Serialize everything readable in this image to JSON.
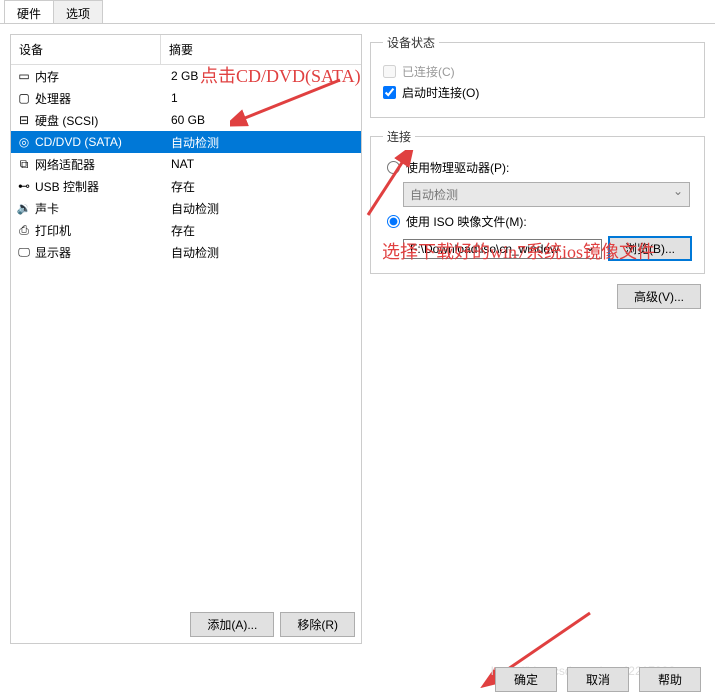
{
  "tabs": {
    "hardware": "硬件",
    "options": "选项"
  },
  "headers": {
    "device": "设备",
    "summary": "摘要"
  },
  "devices": [
    {
      "icon": "memory-icon",
      "glyph": "▭",
      "name": "内存",
      "summary": "2 GB"
    },
    {
      "icon": "cpu-icon",
      "glyph": "▢",
      "name": "处理器",
      "summary": "1"
    },
    {
      "icon": "disk-icon",
      "glyph": "⊟",
      "name": "硬盘 (SCSI)",
      "summary": "60 GB"
    },
    {
      "icon": "cd-icon",
      "glyph": "◎",
      "name": "CD/DVD (SATA)",
      "summary": "自动检测"
    },
    {
      "icon": "network-icon",
      "glyph": "⧉",
      "name": "网络适配器",
      "summary": "NAT"
    },
    {
      "icon": "usb-icon",
      "glyph": "⊷",
      "name": "USB 控制器",
      "summary": "存在"
    },
    {
      "icon": "sound-icon",
      "glyph": "🔉",
      "name": "声卡",
      "summary": "自动检测"
    },
    {
      "icon": "printer-icon",
      "glyph": "⎙",
      "name": "打印机",
      "summary": "存在"
    },
    {
      "icon": "display-icon",
      "glyph": "🖵",
      "name": "显示器",
      "summary": "自动检测"
    }
  ],
  "left_buttons": {
    "add": "添加(A)...",
    "remove": "移除(R)"
  },
  "status": {
    "legend": "设备状态",
    "connected": "已连接(C)",
    "connect_on_start": "启动时连接(O)"
  },
  "connection": {
    "legend": "连接",
    "use_physical": "使用物理驱动器(P):",
    "auto_detect": "自动检测",
    "use_iso": "使用 ISO 映像文件(M):",
    "iso_path": "F:\\Download\\iso\\cn_window",
    "browse": "浏览(B)...",
    "advanced": "高级(V)..."
  },
  "annotations": {
    "click_cd": "点击CD/DVD(SATA)",
    "select_iso": "选择下载好的win7系统ios镜像文件"
  },
  "footer": {
    "ok": "确定",
    "cancel": "取消",
    "help": "帮助"
  },
  "watermark": "https://blog.csdn.net/qq_42217906"
}
